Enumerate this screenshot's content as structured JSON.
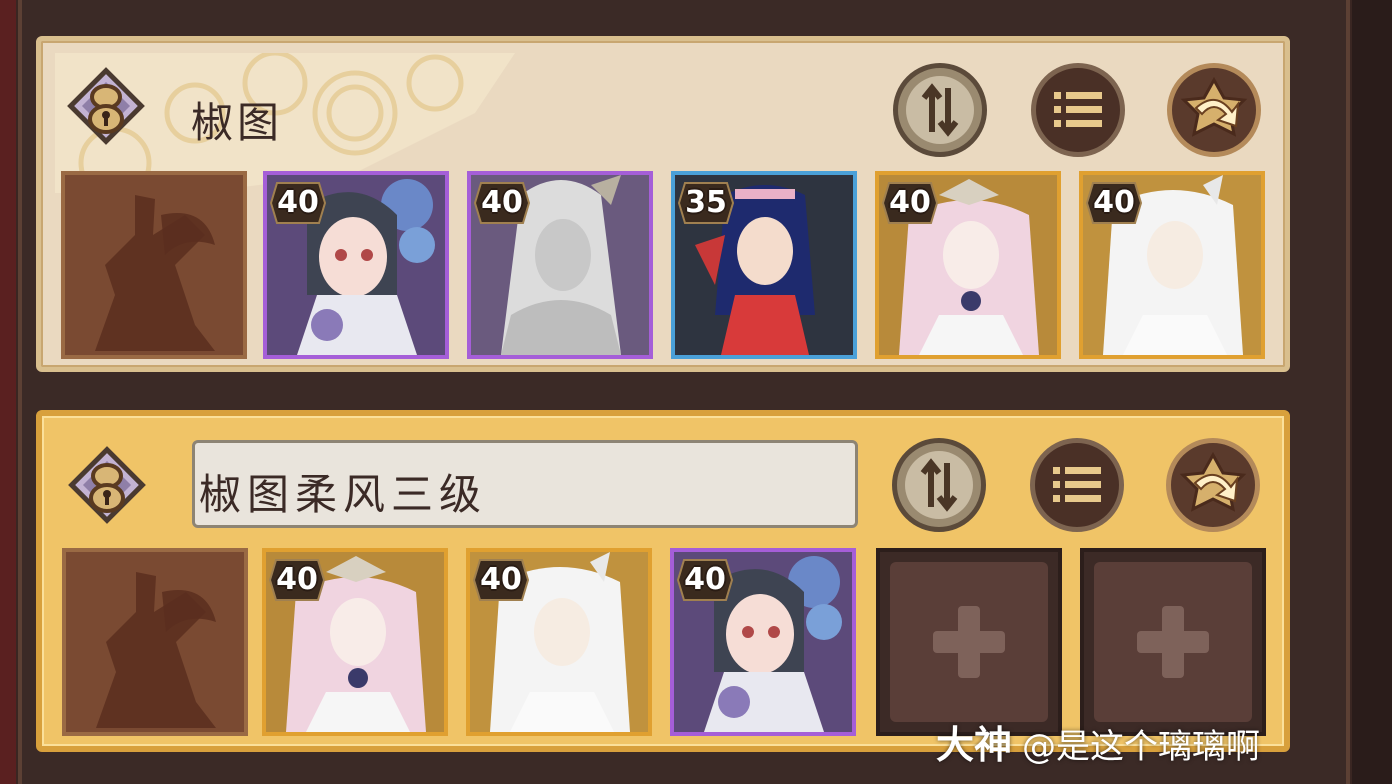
{
  "colors": {
    "rarity_purple": "#a55ed8",
    "rarity_blue": "#4aa0d8",
    "rarity_gold": "#e0a030",
    "panel_inactive": "#ead9c0",
    "panel_active": "#f0c467"
  },
  "teams": [
    {
      "name": "椒图",
      "actions": [
        "sort-icon",
        "list-icon",
        "swap-icon"
      ],
      "onmyoji_icon": "onmyoji-silhouette-icon",
      "shikigami": [
        {
          "level": "40",
          "rarity": "purple"
        },
        {
          "level": "40",
          "rarity": "purple"
        },
        {
          "level": "35",
          "rarity": "blue"
        },
        {
          "level": "40",
          "rarity": "gold"
        },
        {
          "level": "40",
          "rarity": "gold"
        }
      ]
    },
    {
      "name": "椒图柔风三级",
      "actions": [
        "sort-icon",
        "list-icon",
        "swap-icon"
      ],
      "onmyoji_icon": "onmyoji-silhouette-icon",
      "shikigami": [
        {
          "level": "40",
          "rarity": "gold"
        },
        {
          "level": "40",
          "rarity": "gold"
        },
        {
          "level": "40",
          "rarity": "purple"
        }
      ],
      "empty_slots": 2
    }
  ],
  "watermark": {
    "brand": "大神",
    "handle": "@是这个璃璃啊"
  }
}
